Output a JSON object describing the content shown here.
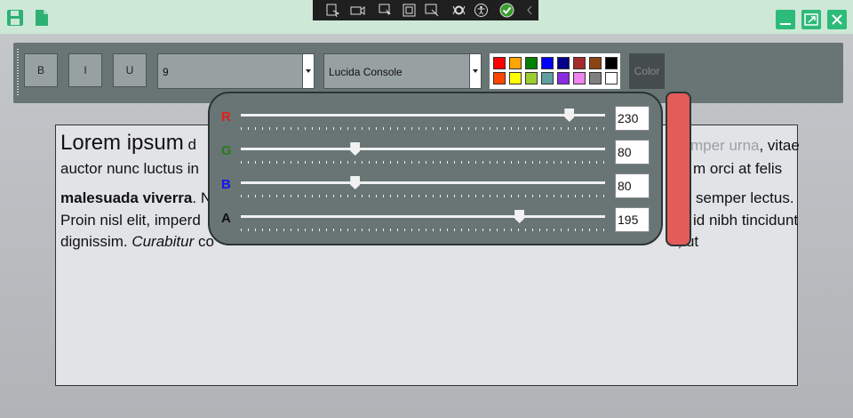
{
  "devtools": {
    "icons": [
      "select-element-icon",
      "video-icon",
      "pointer-icon",
      "frame-icon",
      "inspect-icon",
      "binding-icon",
      "accessibility-icon",
      "check-icon",
      "collapse-icon"
    ]
  },
  "toolbar": {
    "bold_label": "B",
    "italic_label": "I",
    "underline_label": "U",
    "font_size": "9",
    "font_family": "Lucida Console",
    "color_label": "Color",
    "palette": [
      "#ff0000",
      "#ffa500",
      "#008000",
      "#0000ff",
      "#00008b",
      "#a52a2a",
      "#8b4513",
      "#000000",
      "#ff4500",
      "#ffff00",
      "#9acd32",
      "#5f9ea0",
      "#8a2be2",
      "#ee82ee",
      "#808080",
      "#ffffff"
    ]
  },
  "document": {
    "line1_big": "Lorem ipsum",
    "line1_rest": " d",
    "line1_right_faded": "mper urna",
    "line1_right_end": ", vitae",
    "line2_left": "auctor nunc luctus in",
    "line2_right": "m orci at felis",
    "line3_bold": "malesuada viverra",
    "line3_rest": ". N",
    "line3_right": "semper lectus.",
    "line4_left": "Proin nisl elit, imperd",
    "line4_right": "id nibh tincidunt",
    "line5_left": "dignissim. ",
    "line5_italic": "Curabitur",
    "line5_rest": " co",
    "line5_right": "s, ut"
  },
  "color_picker": {
    "channels": [
      {
        "label": "R",
        "value": "230",
        "color": "#e51d1d",
        "level": 0.902
      },
      {
        "label": "G",
        "value": "80",
        "color": "#2a7a20",
        "level": 0.314
      },
      {
        "label": "B",
        "value": "80",
        "color": "#1515ee",
        "level": 0.314
      },
      {
        "label": "A",
        "value": "195",
        "color": "#111111",
        "level": 0.765
      }
    ],
    "preview_color": "#e25c5a"
  }
}
